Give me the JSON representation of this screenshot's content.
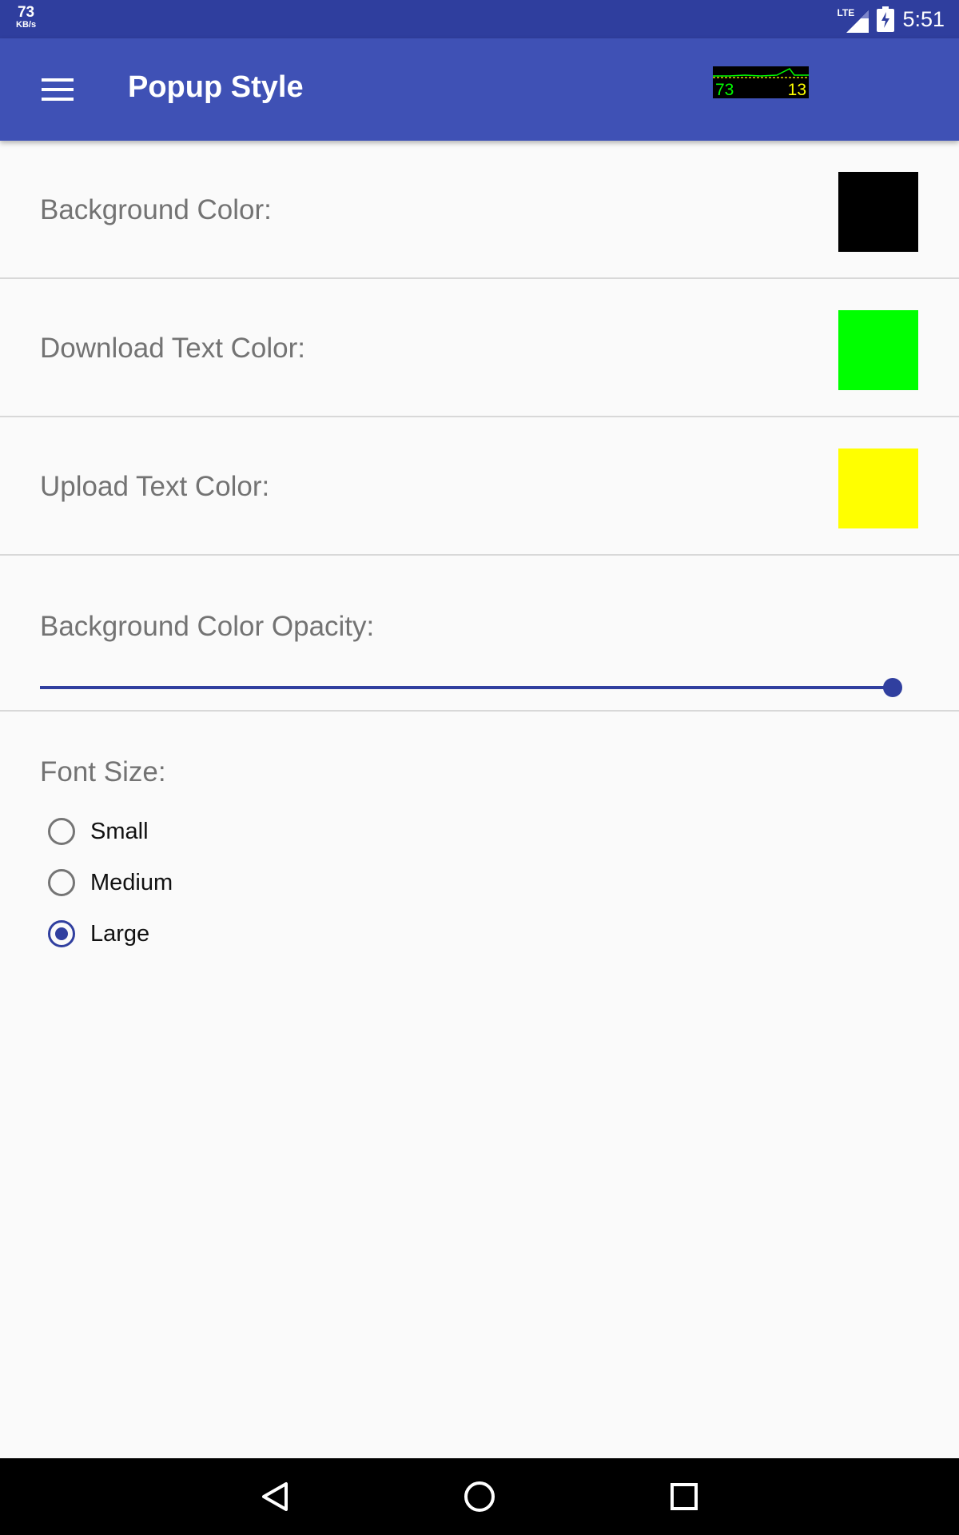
{
  "status_bar": {
    "net_speed_value": "73",
    "net_speed_unit": "KB/s",
    "network_type": "LTE",
    "time": "5:51",
    "icons": [
      "signal-icon",
      "battery-charging-icon"
    ]
  },
  "app_bar": {
    "title": "Popup Style",
    "menu_icon": "hamburger-menu-icon",
    "speed_widget": {
      "download": "73",
      "upload": "13"
    }
  },
  "settings": {
    "background_color": {
      "label": "Background Color:",
      "color": "#000000"
    },
    "download_text_color": {
      "label": "Download Text Color:",
      "color": "#00ff00"
    },
    "upload_text_color": {
      "label": "Upload Text Color:",
      "color": "#ffff00"
    },
    "opacity": {
      "label": "Background Color Opacity:",
      "value_fraction": 1.0
    },
    "font_size": {
      "label": "Font Size:",
      "options": [
        {
          "label": "Small",
          "checked": false
        },
        {
          "label": "Medium",
          "checked": false
        },
        {
          "label": "Large",
          "checked": true
        }
      ]
    }
  },
  "nav_bar": {
    "icons": [
      "back-icon",
      "home-icon",
      "recents-icon"
    ]
  },
  "colors": {
    "status_bar": "#2f3e9e",
    "app_bar": "#3f51b5",
    "accent": "#303f9f",
    "background": "#fafafa"
  }
}
